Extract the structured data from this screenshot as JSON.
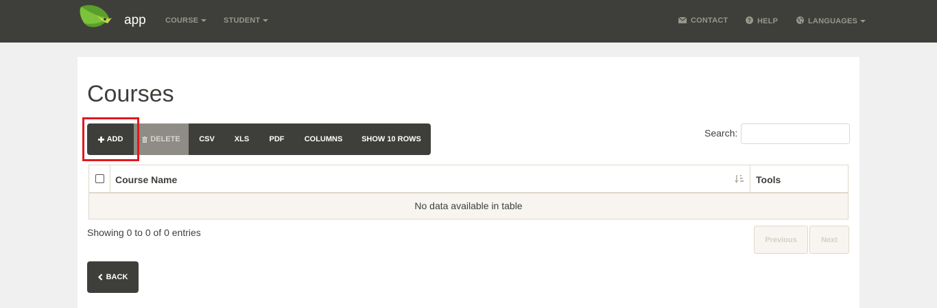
{
  "navbar": {
    "brand": "app",
    "menus": [
      {
        "label": "COURSE"
      },
      {
        "label": "STUDENT"
      }
    ],
    "right": [
      {
        "label": "CONTACT",
        "icon": "envelope-icon"
      },
      {
        "label": "HELP",
        "icon": "question-circle-icon"
      },
      {
        "label": "LANGUAGES",
        "icon": "globe-icon"
      }
    ]
  },
  "page": {
    "title": "Courses"
  },
  "toolbar": {
    "add": "ADD",
    "delete": "DELETE",
    "csv": "CSV",
    "xls": "XLS",
    "pdf": "PDF",
    "columns": "COLUMNS",
    "show_rows": "SHOW 10 ROWS"
  },
  "search": {
    "label": "Search:",
    "value": ""
  },
  "table": {
    "columns": [
      "Course Name",
      "Tools"
    ],
    "empty_message": "No data available in table"
  },
  "info": "Showing 0 to 0 of 0 entries",
  "pagination": {
    "previous": "Previous",
    "next": "Next"
  },
  "back": "BACK",
  "colors": {
    "navbar": "#3e3f3a",
    "accent_leaf": "#6fb32f",
    "highlight": "#e2171f",
    "button_dark": "#3e3f3a",
    "button_disabled": "#8e8c84"
  }
}
